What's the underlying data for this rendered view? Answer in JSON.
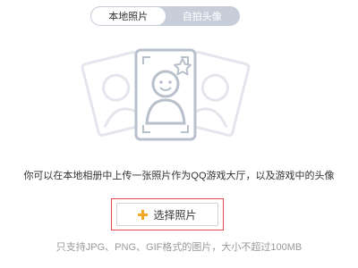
{
  "tabs": [
    {
      "label": "本地照片",
      "active": true
    },
    {
      "label": "自拍头像",
      "active": false
    }
  ],
  "illustration": {
    "icons": [
      "photo-frame-icon",
      "person-avatar-icon",
      "star-icon"
    ]
  },
  "description": "你可以在本地相册中上传一张照片作为QQ游戏大厅，以及游戏中的头像",
  "choose_button": {
    "label": "选择照片",
    "icon": "plus-icon",
    "icon_color": "#f5a623",
    "highlight_color": "#e8494b"
  },
  "hint": "只支持JPG、PNG、GIF格式的图片，大小不超过100MB"
}
